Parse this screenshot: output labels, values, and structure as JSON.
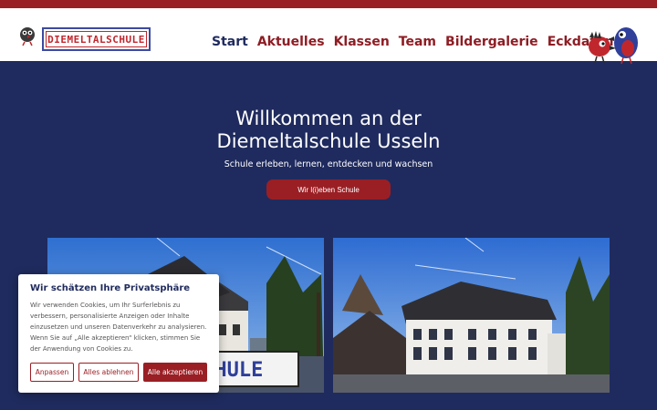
{
  "header": {
    "logo_text": "DIEMELTALSCHULE",
    "nav": [
      {
        "label": "Start",
        "active": true
      },
      {
        "label": "Aktuelles",
        "active": false
      },
      {
        "label": "Klassen",
        "active": false
      },
      {
        "label": "Team",
        "active": false
      },
      {
        "label": "Bildergalerie",
        "active": false
      },
      {
        "label": "Eckdaten",
        "active": false
      }
    ]
  },
  "hero": {
    "title_line1": "Willkommen an der",
    "title_line2": "Diemeltalschule Usseln",
    "subtitle": "Schule erleben, lernen, entdecken und wachsen",
    "button_label": "Wir l(i)eben Schule"
  },
  "photos": {
    "left_sign_text": "LSCHULE"
  },
  "cookie": {
    "title": "Wir schätzen Ihre Privatsphäre",
    "text": "Wir verwenden Cookies, um Ihr Surferlebnis zu verbessern, personalisierte Anzeigen oder Inhalte einzusetzen und unseren Datenverkehr zu analysieren. Wenn Sie auf „Alle akzeptieren“ klicken, stimmen Sie der Anwendung von Cookies zu.",
    "btn_customize": "Anpassen",
    "btn_reject": "Alles ablehnen",
    "btn_accept": "Alle akzeptieren"
  },
  "colors": {
    "brand_red": "#9a1f24",
    "navy": "#1f2b5e",
    "white": "#ffffff"
  }
}
